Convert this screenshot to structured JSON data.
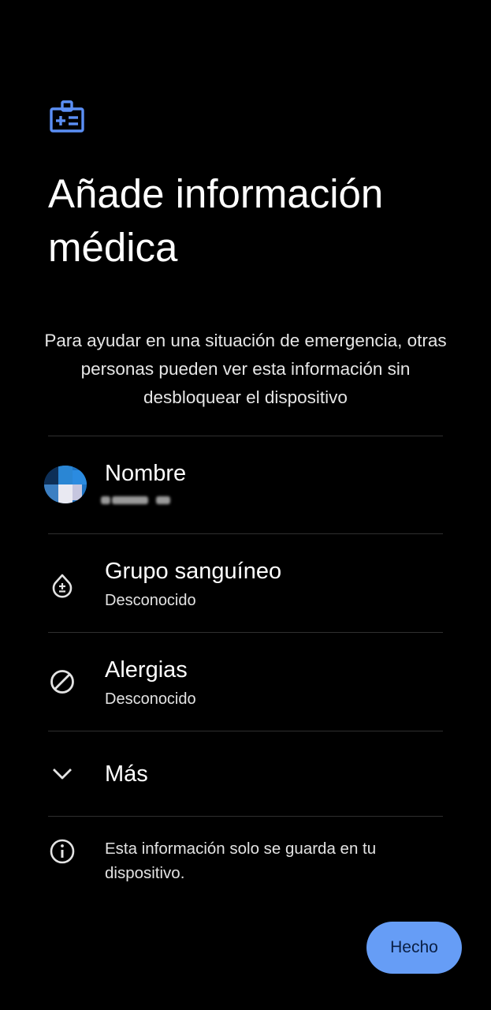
{
  "title": "Añade información médica",
  "description": "Para ayudar en una situación de emergencia, otras personas pueden ver esta información sin desbloquear el dispositivo",
  "header_icon": "medical-id-card-icon",
  "rows": [
    {
      "icon": "avatar",
      "label": "Nombre"
    },
    {
      "icon": "blood-drop-icon",
      "label": "Grupo sanguíneo",
      "value": "Desconocido"
    },
    {
      "icon": "block-icon",
      "label": "Alergias",
      "value": "Desconocido"
    }
  ],
  "more": {
    "icon": "chevron-down-icon",
    "label": "Más"
  },
  "info": {
    "icon": "info-icon",
    "text": "Esta información solo se guarda en tu dispositivo."
  },
  "done_button": {
    "label": "Hecho"
  },
  "colors": {
    "background": "#000000",
    "accent": "#669df6",
    "icon_blue": "#5b8ff5",
    "divider": "#2f2f2f"
  }
}
